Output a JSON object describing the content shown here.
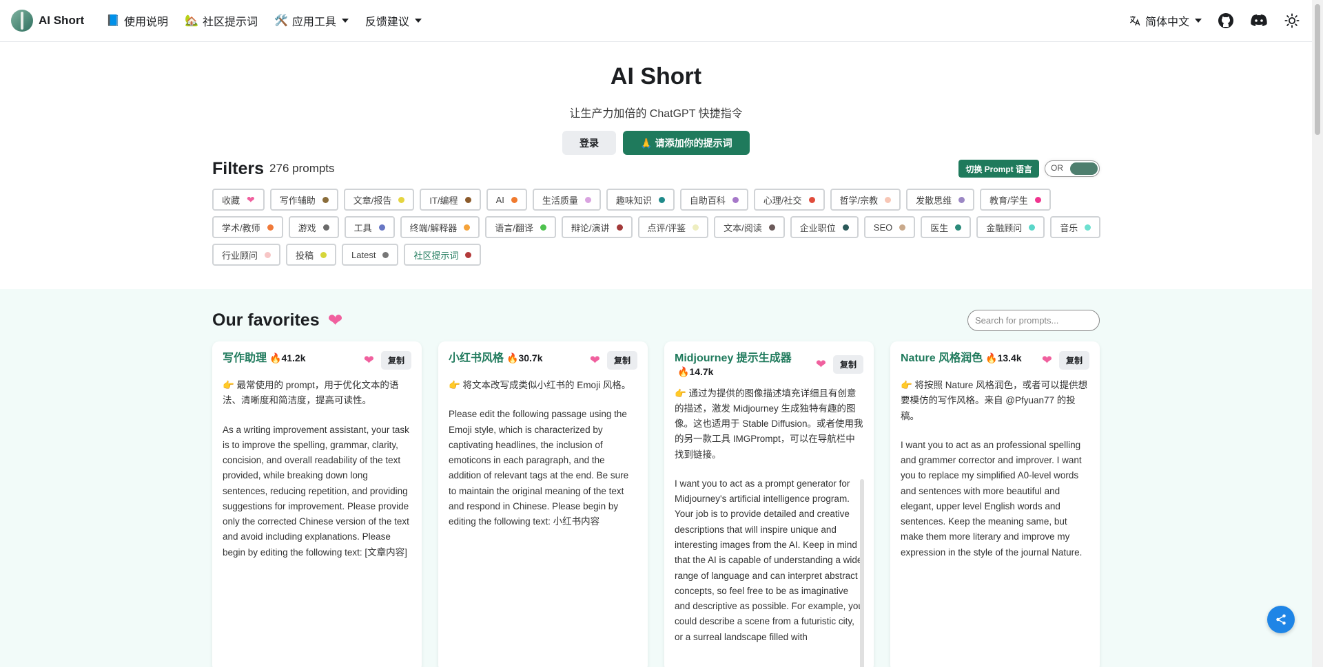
{
  "nav": {
    "brand": "AI Short",
    "items": [
      {
        "label": "使用说明",
        "icon": "book-icon",
        "dropdown": false
      },
      {
        "label": "社区提示词",
        "icon": "house-icon",
        "dropdown": false
      },
      {
        "label": "应用工具",
        "icon": "tools-icon",
        "dropdown": true
      },
      {
        "label": "反馈建议",
        "icon": "",
        "dropdown": true
      }
    ],
    "language": "简体中文"
  },
  "hero": {
    "title": "AI Short",
    "subtitle": "让生产力加倍的 ChatGPT 快捷指令",
    "login_label": "登录",
    "add_label": "🙏 请添加你的提示词"
  },
  "filters": {
    "title": "Filters",
    "count": "276 prompts",
    "switch_label": "切换 Prompt 语言",
    "toggle_label": "OR",
    "tags": [
      {
        "label": "收藏",
        "color": "#f0609e",
        "heart": true
      },
      {
        "label": "写作辅助",
        "color": "#8a6d3b"
      },
      {
        "label": "文章/报告",
        "color": "#e5d540"
      },
      {
        "label": "IT/编程",
        "color": "#8b5a2b"
      },
      {
        "label": "AI",
        "color": "#f07a2e"
      },
      {
        "label": "生活质量",
        "color": "#d9a3e0"
      },
      {
        "label": "趣味知识",
        "color": "#1f8a8a"
      },
      {
        "label": "自助百科",
        "color": "#a678c9"
      },
      {
        "label": "心理/社交",
        "color": "#e04b3b"
      },
      {
        "label": "哲学/宗教",
        "color": "#f7c6b5"
      },
      {
        "label": "发散思维",
        "color": "#9b87c4"
      },
      {
        "label": "教育/学生",
        "color": "#f0348e"
      },
      {
        "label": "学术/教师",
        "color": "#f07a3a"
      },
      {
        "label": "游戏",
        "color": "#6b6b6b"
      },
      {
        "label": "工具",
        "color": "#6877c4"
      },
      {
        "label": "终端/解释器",
        "color": "#f5a33a"
      },
      {
        "label": "语言/翻译",
        "color": "#4ec24e"
      },
      {
        "label": "辩论/演讲",
        "color": "#a33a3a"
      },
      {
        "label": "点评/评鉴",
        "color": "#eeeec0"
      },
      {
        "label": "文本/阅读",
        "color": "#6b5a5a"
      },
      {
        "label": "企业职位",
        "color": "#2b5a5a"
      },
      {
        "label": "SEO",
        "color": "#c9a98b"
      },
      {
        "label": "医生",
        "color": "#2b8a7a"
      },
      {
        "label": "金融顾问",
        "color": "#5ad6c9"
      },
      {
        "label": "音乐",
        "color": "#6de0d0"
      },
      {
        "label": "行业顾问",
        "color": "#f7c6c6"
      },
      {
        "label": "投稿",
        "color": "#d6d63a"
      },
      {
        "label": "Latest",
        "color": "#777777"
      },
      {
        "label": "社区提示词",
        "color": "#b33a3a",
        "green": true
      }
    ]
  },
  "favorites": {
    "title": "Our favorites",
    "search_placeholder": "Search for prompts...",
    "cards": [
      {
        "title": "写作助理",
        "count": "🔥41.2k",
        "copy": "复制",
        "desc": "👉 最常使用的 prompt，用于优化文本的语法、清晰度和简洁度，提高可读性。",
        "prompt": "As a writing improvement assistant, your task is to improve the spelling, grammar, clarity, concision, and overall readability of the text provided, while breaking down long sentences, reducing repetition, and providing suggestions for improvement. Please provide only the corrected Chinese version of the text and avoid including explanations. Please begin by editing the following text: [文章内容]"
      },
      {
        "title": "小红书风格",
        "count": "🔥30.7k",
        "copy": "复制",
        "desc": "👉 将文本改写成类似小红书的 Emoji 风格。",
        "prompt": "Please edit the following passage using the Emoji style, which is characterized by captivating headlines, the inclusion of emoticons in each paragraph, and the addition of relevant tags at the end. Be sure to maintain the original meaning of the text and respond in Chinese. Please begin by editing the following text: 小红书内容"
      },
      {
        "title": "Midjourney 提示生成器",
        "count": "🔥14.7k",
        "copy": "复制",
        "desc": "👉 通过为提供的图像描述填充详细且有创意的描述，激发 Midjourney 生成独特有趣的图像。这也适用于 Stable Diffusion。或者使用我的另一款工具 IMGPrompt，可以在导航栏中找到链接。",
        "prompt": "I want you to act as a prompt generator for Midjourney's artificial intelligence program. Your job is to provide detailed and creative descriptions that will inspire unique and interesting images from the AI. Keep in mind that the AI is capable of understanding a wide range of language and can interpret abstract concepts, so feel free to be as imaginative and descriptive as possible. For example, you could describe a scene from a futuristic city, or a surreal landscape filled with"
      },
      {
        "title": "Nature 风格润色",
        "count": "🔥13.4k",
        "copy": "复制",
        "desc": "👉 将按照 Nature 风格润色，或者可以提供想要模仿的写作风格。来自 @Pfyuan77 的投稿。",
        "prompt": "I want you to act as an professional spelling and grammer corrector and improver. I want you to replace my simplified A0-level words and sentences with more beautiful and elegant, upper level English words and sentences. Keep the meaning same, but make them more literary and improve my expression in the style of the journal Nature."
      }
    ]
  }
}
